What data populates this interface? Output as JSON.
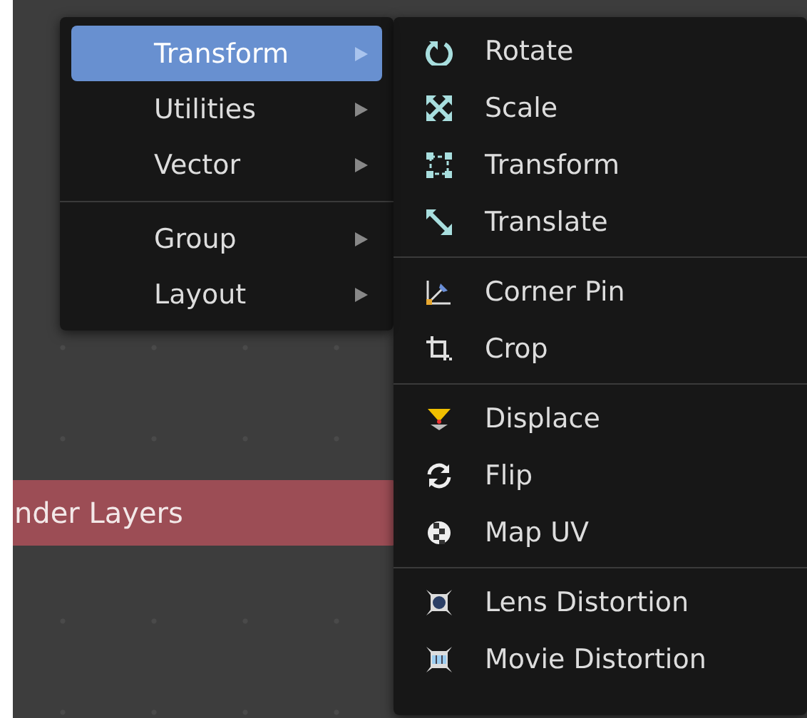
{
  "canvas": {
    "node": {
      "title": "nder Layers"
    }
  },
  "menu": {
    "sections": [
      [
        {
          "label": "Transform",
          "selected": true,
          "has_submenu": true
        },
        {
          "label": "Utilities",
          "selected": false,
          "has_submenu": true
        },
        {
          "label": "Vector",
          "selected": false,
          "has_submenu": true
        }
      ],
      [
        {
          "label": "Group",
          "selected": false,
          "has_submenu": true
        },
        {
          "label": "Layout",
          "selected": false,
          "has_submenu": true
        }
      ]
    ]
  },
  "submenu": {
    "sections": [
      [
        {
          "label": "Rotate",
          "kind": "rotate"
        },
        {
          "label": "Scale",
          "kind": "scale"
        },
        {
          "label": "Transform",
          "kind": "transform"
        },
        {
          "label": "Translate",
          "kind": "translate"
        }
      ],
      [
        {
          "label": "Corner Pin",
          "kind": "corner-pin"
        },
        {
          "label": "Crop",
          "kind": "crop"
        }
      ],
      [
        {
          "label": "Displace",
          "kind": "displace"
        },
        {
          "label": "Flip",
          "kind": "flip"
        },
        {
          "label": "Map UV",
          "kind": "map-uv"
        }
      ],
      [
        {
          "label": "Lens Distortion",
          "kind": "lens"
        },
        {
          "label": "Movie Distortion",
          "kind": "movie"
        }
      ]
    ]
  }
}
